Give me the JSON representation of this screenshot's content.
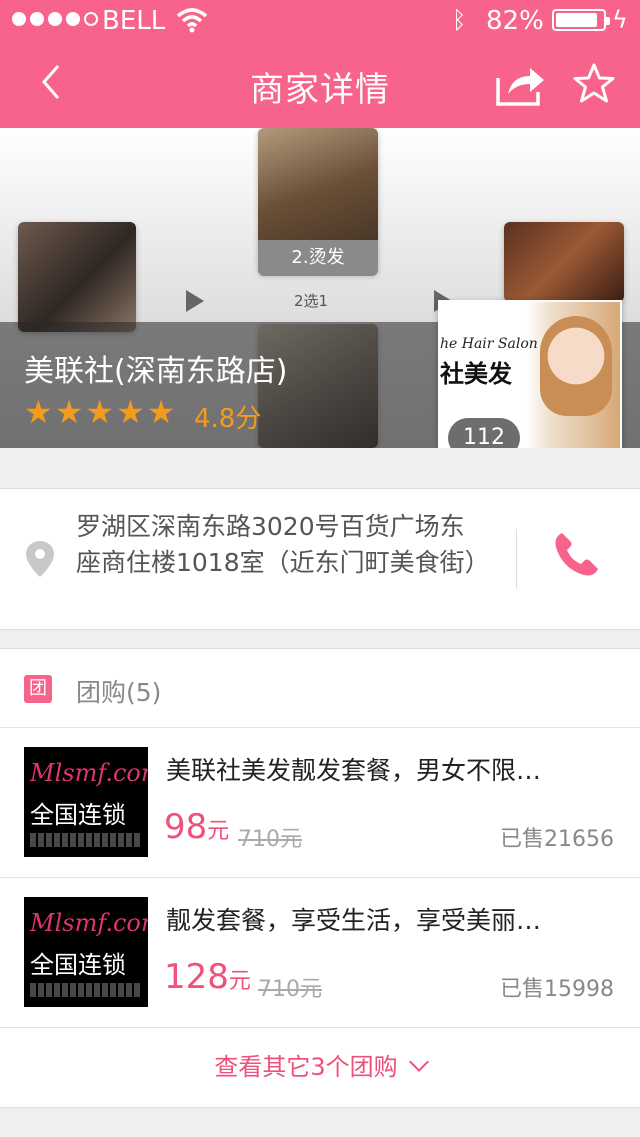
{
  "status_bar": {
    "carrier": "BELL",
    "battery_percent": "82%",
    "battery_level": 0.82
  },
  "nav": {
    "title": "商家详情",
    "back_icon": "chevron-left-icon",
    "share_icon": "share-icon",
    "favorite_icon": "star-outline-icon"
  },
  "banner": {
    "step_label": "2.烫发",
    "choice_label": "2选1",
    "shop_name": "美联社(深南东路店)",
    "rating_stars": 5,
    "rating_text": "4.8分",
    "thumb_brand_en": "he Hair Salon",
    "thumb_brand_cn": "社美发",
    "photo_count": "112"
  },
  "address": {
    "text": "罗湖区深南东路3020号百货广场东座商住楼1018室（近东门町美食街）",
    "pin_icon": "map-pin-icon",
    "phone_icon": "phone-icon"
  },
  "group_buy": {
    "title": "团购(5)",
    "icon_label": "团",
    "deals": [
      {
        "image_logo": "Mlsmf.com",
        "image_text": "全国连锁",
        "name": "美联社美发靓发套餐，男女不限…",
        "price": "98",
        "price_unit": "元",
        "original_price": "710元",
        "sold": "已售21656"
      },
      {
        "image_logo": "Mlsmf.com",
        "image_text": "全国连锁",
        "name": "靓发套餐，享受生活，享受美丽…",
        "price": "128",
        "price_unit": "元",
        "original_price": "710元",
        "sold": "已售15998"
      }
    ],
    "more_label": "查看其它3个团购"
  },
  "colors": {
    "brand": "#f7638a",
    "price": "#f0507a",
    "rating": "#f59b1c"
  }
}
